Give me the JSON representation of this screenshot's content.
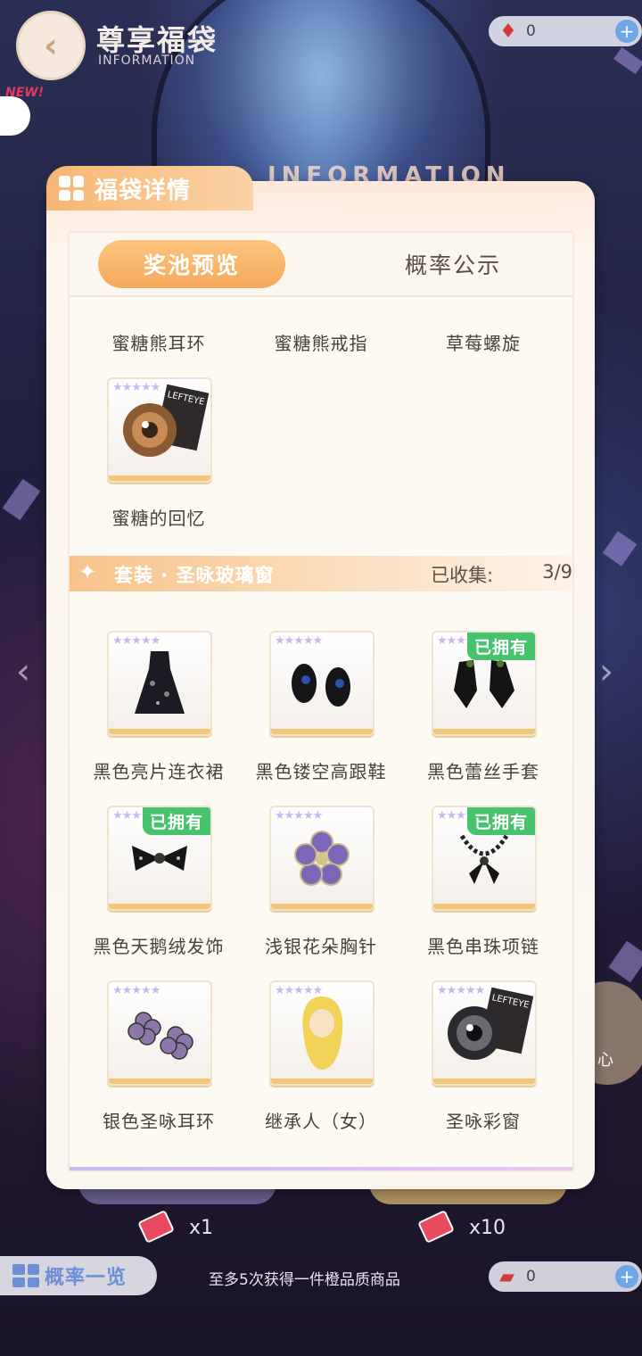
{
  "header": {
    "title": "尊享福袋",
    "subtitle": "INFORMATION",
    "back_icon": "back-arrow-icon",
    "banner": "INFORMATION"
  },
  "currency_top": {
    "value": "0",
    "icon": "flame-gem-icon"
  },
  "currency_bottom": {
    "value": "0",
    "icon": "ticket-icon"
  },
  "new_badge": "NEW!",
  "panel": {
    "title": "福袋详情",
    "tabs": [
      {
        "label": "奖池预览",
        "active": true
      },
      {
        "label": "概率公示",
        "active": false
      }
    ],
    "partial_row": [
      "蜜糖熊耳环",
      "蜜糖熊戒指",
      "草莓螺旋"
    ],
    "single_item": {
      "name": "蜜糖的回忆",
      "tag": "LEFTEYE"
    },
    "set": {
      "spark": "✦",
      "name": "套装 · 圣咏玻璃窗",
      "collected_label": "已收集:",
      "collected_value": "3/9"
    },
    "owned_label": "已拥有",
    "items": [
      {
        "name": "黑色亮片连衣裙",
        "owned": false,
        "icon": "black-dress-icon"
      },
      {
        "name": "黑色镂空高跟鞋",
        "owned": false,
        "icon": "heels-icon"
      },
      {
        "name": "黑色蕾丝手套",
        "owned": true,
        "icon": "gloves-icon"
      },
      {
        "name": "黑色天鹅绒发饰",
        "owned": true,
        "icon": "hair-bow-icon"
      },
      {
        "name": "浅银花朵胸针",
        "owned": false,
        "icon": "flower-brooch-icon"
      },
      {
        "name": "黑色串珠项链",
        "owned": true,
        "icon": "necklace-icon"
      },
      {
        "name": "银色圣咏耳环",
        "owned": false,
        "icon": "earrings-icon"
      },
      {
        "name": "继承人（女）",
        "owned": false,
        "icon": "blonde-hair-icon"
      },
      {
        "name": "圣咏彩窗",
        "owned": false,
        "icon": "eye-lens-icon",
        "tag": "LEFTEYE"
      }
    ]
  },
  "bottom": {
    "draw_single_qty": "x1",
    "draw_ten_qty": "x10",
    "probability_btn": "概率一览",
    "hint": "至多5次获得一件橙品质商品",
    "side_btn": "心"
  },
  "colors": {
    "accent": "#f5a95c",
    "owned_green": "#47c26d",
    "panel_bg": "#fdf9f3",
    "plus_blue": "#6fa6e8"
  }
}
